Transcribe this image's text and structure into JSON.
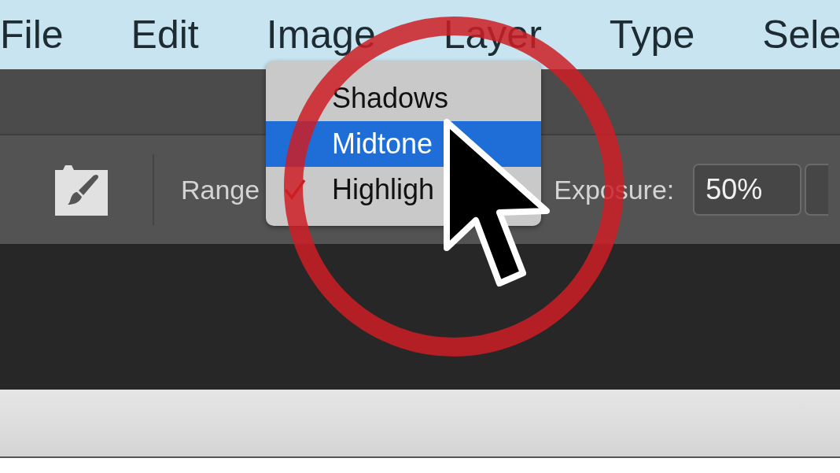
{
  "menu_bar": {
    "items": [
      {
        "label": "File"
      },
      {
        "label": "Edit"
      },
      {
        "label": "Image"
      },
      {
        "label": "Layer"
      },
      {
        "label": "Type"
      },
      {
        "label": "Sele"
      }
    ]
  },
  "options_bar": {
    "range_label": "Range",
    "exposure_label": "Exposure:",
    "exposure_value": "50%"
  },
  "range_menu": {
    "items": [
      {
        "label": "Shadows",
        "selected": false,
        "checked": false
      },
      {
        "label": "Midtone",
        "selected": true,
        "checked": false
      },
      {
        "label": "Highligh",
        "selected": false,
        "checked": true
      }
    ]
  }
}
